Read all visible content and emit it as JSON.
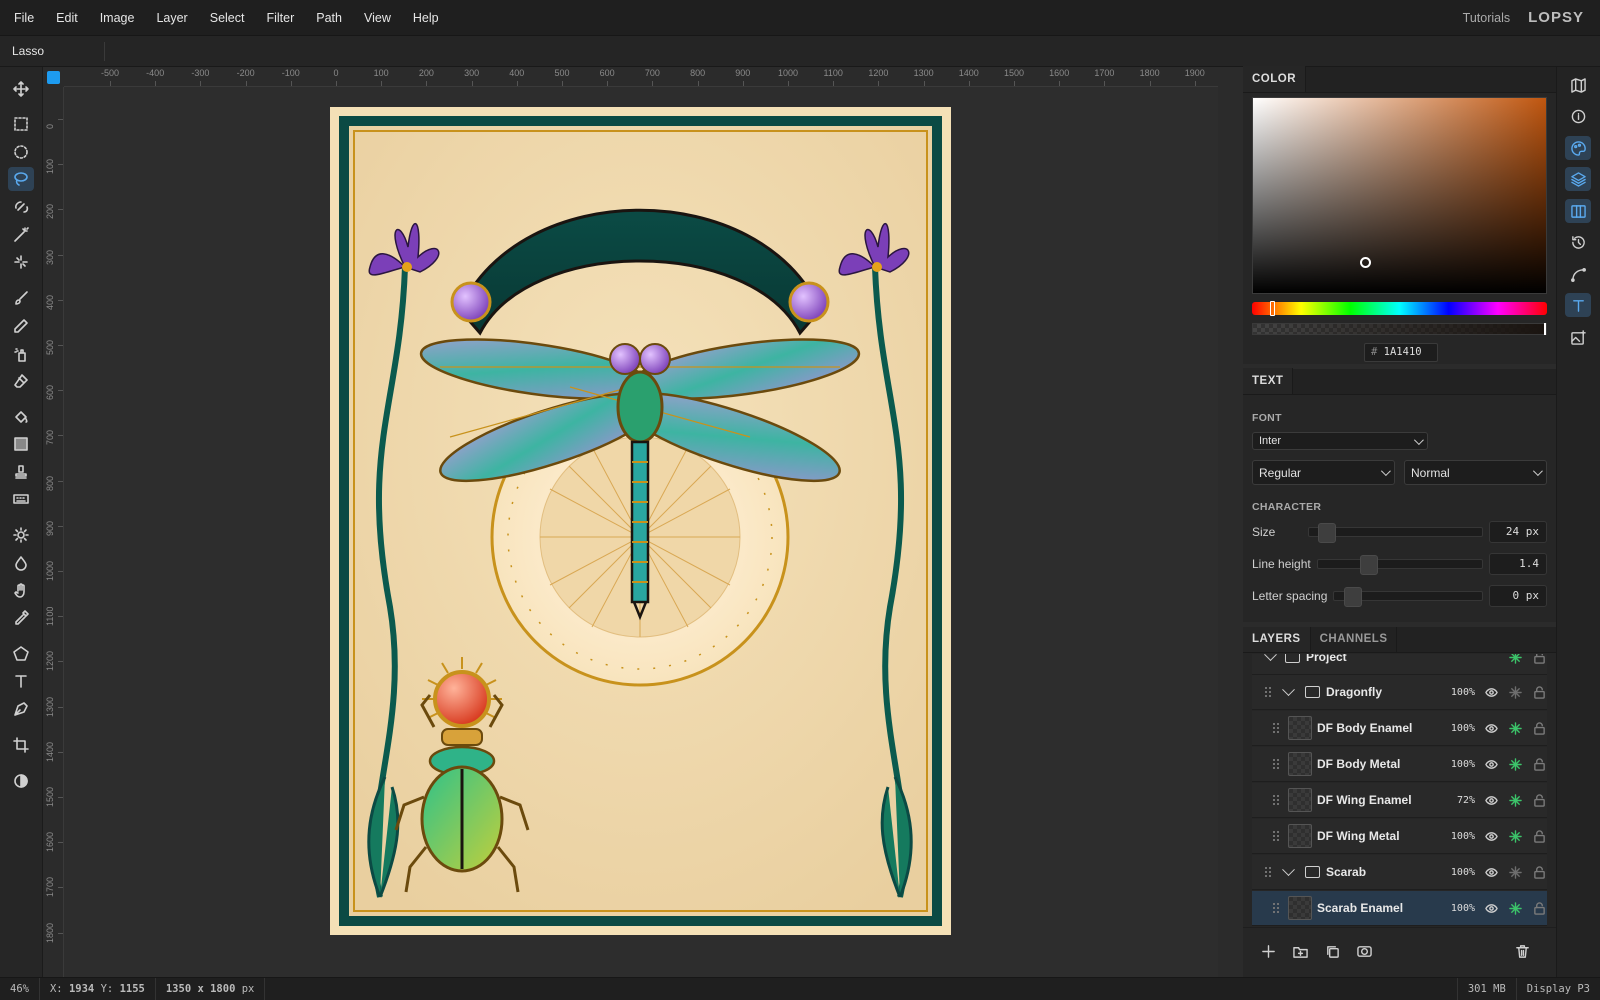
{
  "menu": [
    "File",
    "Edit",
    "Image",
    "Layer",
    "Select",
    "Filter",
    "Path",
    "View",
    "Help"
  ],
  "topbar": {
    "tutorials": "Tutorials",
    "logo": "LOPSY"
  },
  "options": {
    "tool_name": "Lasso"
  },
  "tools": [
    "move-tool",
    "rect-select-tool",
    "ellipse-select-tool",
    "lasso-tool",
    "quick-select-tool",
    "magic-wand-tool",
    "spot-heal-tool",
    "brush-tool",
    "pencil-tool",
    "clone-tool",
    "eraser-tool",
    "fill-tool",
    "gradient-tool",
    "stamp-tool",
    "pattern-tool",
    "dodge-tool",
    "blur-tool",
    "hand-tool",
    "eyedropper-tool",
    "polygon-tool",
    "text-tool",
    "pen-tool",
    "crop-tool",
    "contrast-tool"
  ],
  "active_tool": "lasso-tool",
  "ruler": {
    "h": [
      "-500",
      "-400",
      "-300",
      "-200",
      "-100",
      "0",
      "100",
      "200",
      "300",
      "400",
      "500",
      "600",
      "700",
      "800",
      "900",
      "1000",
      "1100",
      "1200",
      "1300",
      "1400",
      "1500",
      "1600",
      "1700",
      "1800",
      "1900"
    ],
    "v": [
      "0",
      "100",
      "200",
      "300",
      "400",
      "500",
      "600",
      "700",
      "800",
      "900",
      "1000",
      "1100",
      "1200",
      "1300",
      "1400",
      "1500",
      "1600",
      "1700",
      "1800"
    ]
  },
  "color_panel": {
    "title": "COLOR",
    "hex_prefix": "#",
    "hex": "1A1410",
    "hue_color": "#c0560f"
  },
  "text_panel": {
    "title": "TEXT",
    "font_label": "FONT",
    "font": "Inter",
    "weight": "Regular",
    "style": "Normal",
    "character_label": "CHARACTER",
    "size_label": "Size",
    "size_value": "24 px",
    "lineheight_label": "Line height",
    "lineheight_value": "1.4",
    "spacing_label": "Letter spacing",
    "spacing_value": "0 px"
  },
  "layers_panel": {
    "tabs": [
      "LAYERS",
      "CHANNELS"
    ],
    "project": "Project",
    "layers": [
      {
        "name": "Dragonfly",
        "opacity": "100%",
        "group": true
      },
      {
        "name": "DF Body Enamel",
        "opacity": "100%"
      },
      {
        "name": "DF Body Metal",
        "opacity": "100%"
      },
      {
        "name": "DF Wing Enamel",
        "opacity": "72%"
      },
      {
        "name": "DF Wing Metal",
        "opacity": "100%"
      },
      {
        "name": "Scarab",
        "opacity": "100%",
        "group": true
      },
      {
        "name": "Scarab Enamel",
        "opacity": "100%",
        "selected": true
      }
    ]
  },
  "status": {
    "zoom": "46%",
    "coords_x_label": "X:",
    "coords_x": "1934",
    "coords_y_label": "Y:",
    "coords_y": "1155",
    "doc_size": "1350 x 1800",
    "doc_unit": "px",
    "memory": "301 MB",
    "profile": "Display P3"
  }
}
